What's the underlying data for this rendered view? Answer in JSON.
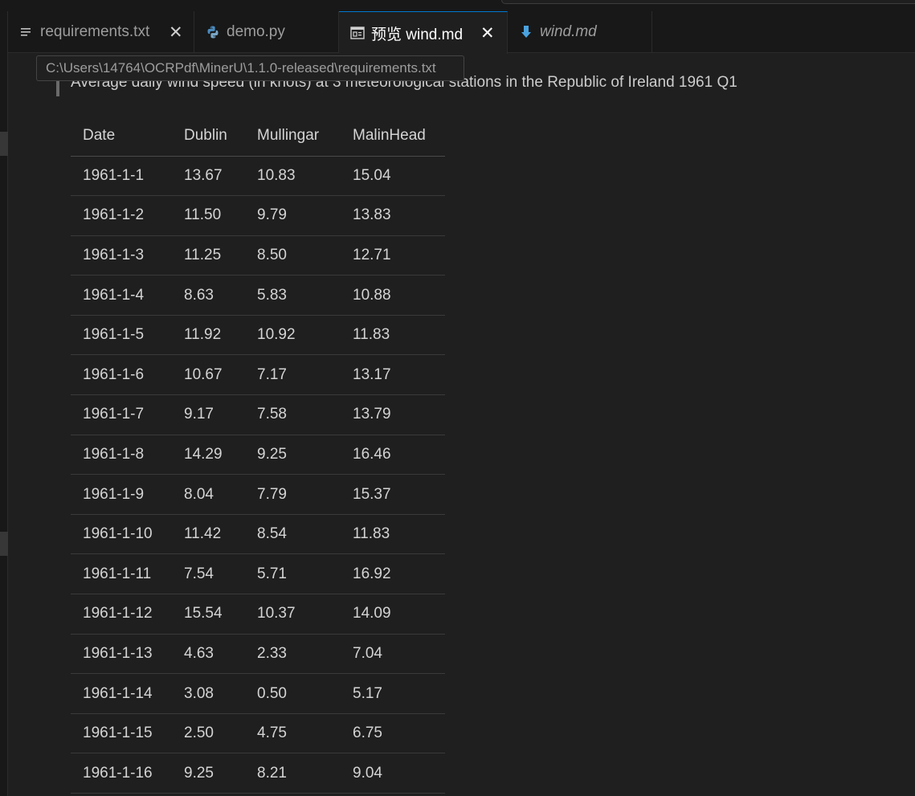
{
  "tabs": [
    {
      "label": "requirements.txt",
      "icon": "text-file-icon",
      "close": "✕",
      "italic": false
    },
    {
      "label": "demo.py",
      "icon": "python-icon",
      "italic": false
    },
    {
      "label": "预览 wind.md",
      "icon": "preview-icon",
      "close": "✕",
      "italic": false,
      "active": true
    },
    {
      "label": "wind.md",
      "icon": "markdown-icon",
      "italic": true
    }
  ],
  "tooltip": "C:\\Users\\14764\\OCRPdf\\MinerU\\1.1.0-released\\requirements.txt",
  "document": {
    "caption": "Average daily wind speed (in knots) at 3 meteorological stations in the Republic of Ireland 1961 Q1",
    "table": {
      "headers": [
        "Date",
        "Dublin",
        "Mullingar",
        "MalinHead"
      ],
      "rows": [
        [
          "1961-1-1",
          "13.67",
          "10.83",
          "15.04"
        ],
        [
          "1961-1-2",
          "11.50",
          "9.79",
          "13.83"
        ],
        [
          "1961-1-3",
          "11.25",
          "8.50",
          "12.71"
        ],
        [
          "1961-1-4",
          "8.63",
          "5.83",
          "10.88"
        ],
        [
          "1961-1-5",
          "11.92",
          "10.92",
          "11.83"
        ],
        [
          "1961-1-6",
          "10.67",
          "7.17",
          "13.17"
        ],
        [
          "1961-1-7",
          "9.17",
          "7.58",
          "13.79"
        ],
        [
          "1961-1-8",
          "14.29",
          "9.25",
          "16.46"
        ],
        [
          "1961-1-9",
          "8.04",
          "7.79",
          "15.37"
        ],
        [
          "1961-1-10",
          "11.42",
          "8.54",
          "11.83"
        ],
        [
          "1961-1-11",
          "7.54",
          "5.71",
          "16.92"
        ],
        [
          "1961-1-12",
          "15.54",
          "10.37",
          "14.09"
        ],
        [
          "1961-1-13",
          "4.63",
          "2.33",
          "7.04"
        ],
        [
          "1961-1-14",
          "3.08",
          "0.50",
          "5.17"
        ],
        [
          "1961-1-15",
          "2.50",
          "4.75",
          "6.75"
        ],
        [
          "1961-1-16",
          "9.25",
          "8.21",
          "9.04"
        ]
      ]
    }
  },
  "colors": {
    "accent": "#0078d4",
    "python": "#4b8bbe",
    "markdown": "#4aa3df"
  }
}
